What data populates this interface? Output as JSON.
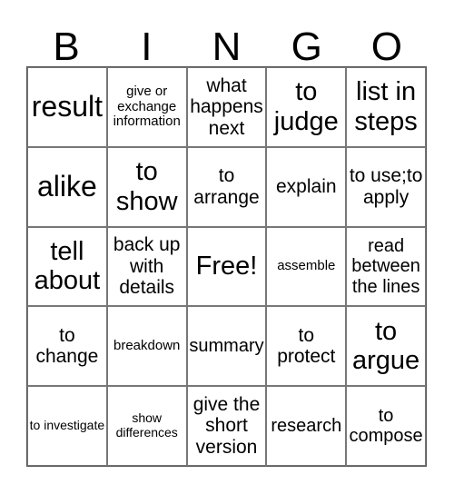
{
  "card": {
    "header": [
      "B",
      "I",
      "N",
      "G",
      "O"
    ],
    "rows": [
      [
        {
          "text": "result",
          "size": "xl"
        },
        {
          "text": "give or exchange information",
          "size": "s"
        },
        {
          "text": "what happens next",
          "size": "m"
        },
        {
          "text": "to judge",
          "size": "l"
        },
        {
          "text": "list in steps",
          "size": "l"
        }
      ],
      [
        {
          "text": "alike",
          "size": "xl"
        },
        {
          "text": "to show",
          "size": "l"
        },
        {
          "text": "to arrange",
          "size": "m"
        },
        {
          "text": "explain",
          "size": "m"
        },
        {
          "text": "to use;to apply",
          "size": "m"
        }
      ],
      [
        {
          "text": "tell about",
          "size": "l"
        },
        {
          "text": "back up with details",
          "size": "m"
        },
        {
          "text": "Free!",
          "size": "l"
        },
        {
          "text": "assemble",
          "size": "s"
        },
        {
          "text": "read between the lines",
          "size": "ms"
        }
      ],
      [
        {
          "text": "to change",
          "size": "m"
        },
        {
          "text": "breakdown",
          "size": "s"
        },
        {
          "text": "summary",
          "size": "ms"
        },
        {
          "text": "to protect",
          "size": "m"
        },
        {
          "text": "to argue",
          "size": "l"
        }
      ],
      [
        {
          "text": "to investigate",
          "size": "xs"
        },
        {
          "text": "show differences",
          "size": "xs"
        },
        {
          "text": "give the short version",
          "size": "m"
        },
        {
          "text": "research",
          "size": "ms"
        },
        {
          "text": "to compose",
          "size": "ms"
        }
      ]
    ]
  }
}
